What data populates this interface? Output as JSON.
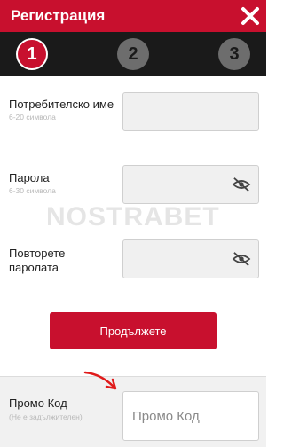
{
  "header": {
    "title": "Регистрация"
  },
  "steps": [
    "1",
    "2",
    "3"
  ],
  "form": {
    "username_label": "Потребителско име",
    "username_hint": "6-20 символа",
    "password_label": "Парола",
    "password_hint": "6-30 символа",
    "repeat_label_line1": "Повторете",
    "repeat_label_line2": "паролата"
  },
  "watermark": "NOSTRABET",
  "continue_label": "Продължете",
  "promo": {
    "label": "Промо Код",
    "hint": "(Не е задължителен)",
    "placeholder": "Промо Код"
  },
  "colors": {
    "brand": "#c8102e",
    "step_bar": "#1a1a1a",
    "step_inactive": "#6d6d6d"
  }
}
